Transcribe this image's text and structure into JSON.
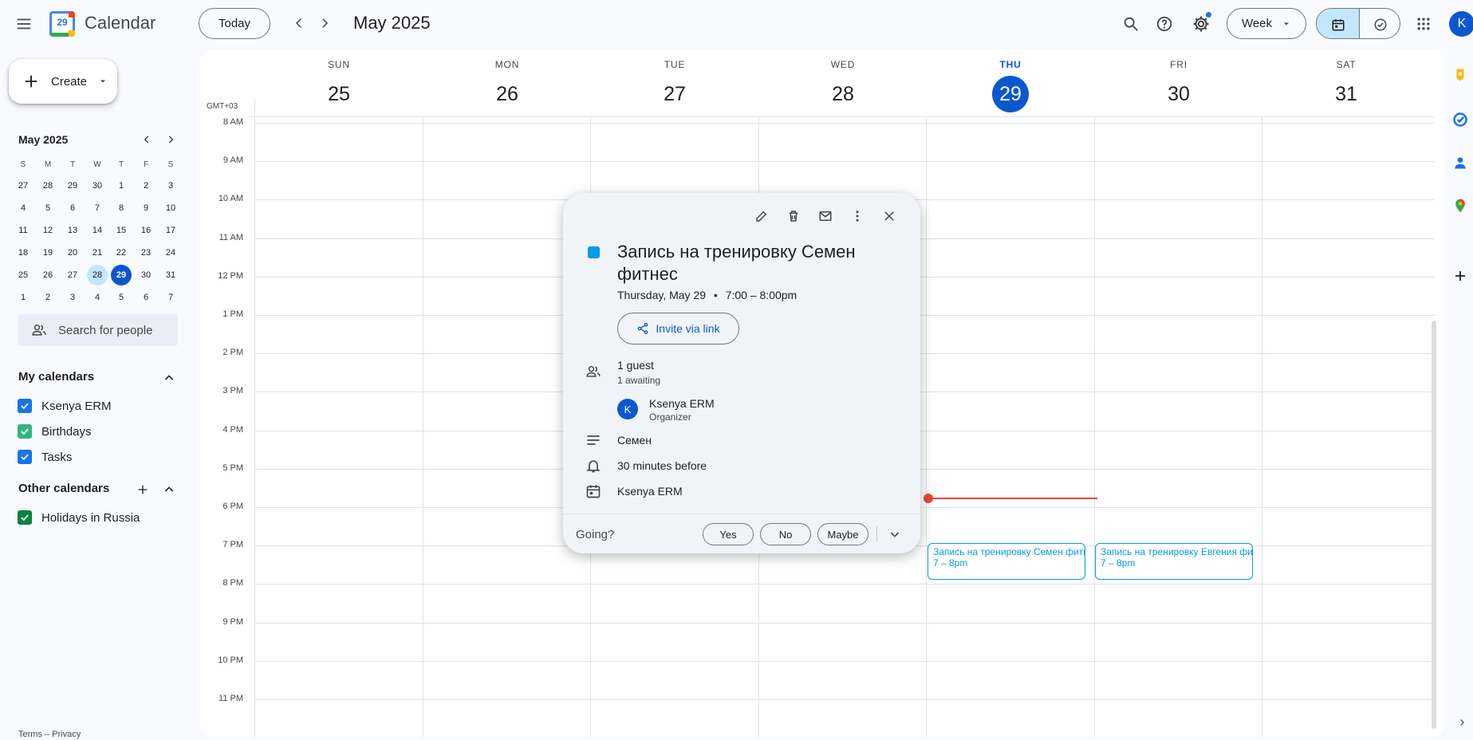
{
  "header": {
    "app_title": "Calendar",
    "logo_day": "29",
    "today_label": "Today",
    "period_title": "May 2025",
    "view_label": "Week",
    "avatar_letter": "K"
  },
  "sidebar": {
    "create_label": "Create",
    "mini_cal": {
      "title": "May 2025",
      "weekday_heads": [
        "S",
        "M",
        "T",
        "W",
        "T",
        "F",
        "S"
      ],
      "weeks": [
        [
          "27",
          "28",
          "29",
          "30",
          "1",
          "2",
          "3"
        ],
        [
          "4",
          "5",
          "6",
          "7",
          "8",
          "9",
          "10"
        ],
        [
          "11",
          "12",
          "13",
          "14",
          "15",
          "16",
          "17"
        ],
        [
          "18",
          "19",
          "20",
          "21",
          "22",
          "23",
          "24"
        ],
        [
          "25",
          "26",
          "27",
          "28",
          "29",
          "30",
          "31"
        ],
        [
          "1",
          "2",
          "3",
          "4",
          "5",
          "6",
          "7"
        ]
      ]
    },
    "search_people_placeholder": "Search for people",
    "my_calendars_title": "My calendars",
    "my_calendars": [
      {
        "label": "Ksenya ERM",
        "color": "#1a73e8"
      },
      {
        "label": "Birthdays",
        "color": "#33b679"
      },
      {
        "label": "Tasks",
        "color": "#1a73e8"
      }
    ],
    "other_calendars_title": "Other calendars",
    "other_calendars": [
      {
        "label": "Holidays in Russia",
        "color": "#0b8043"
      }
    ],
    "footer": "Terms – Privacy"
  },
  "grid": {
    "timezone": "GMT+03",
    "days": [
      {
        "name": "SUN",
        "num": "25"
      },
      {
        "name": "MON",
        "num": "26"
      },
      {
        "name": "TUE",
        "num": "27"
      },
      {
        "name": "WED",
        "num": "28"
      },
      {
        "name": "THU",
        "num": "29"
      },
      {
        "name": "FRI",
        "num": "30"
      },
      {
        "name": "SAT",
        "num": "31"
      }
    ],
    "hours": [
      "8 AM",
      "9 AM",
      "10 AM",
      "11 AM",
      "12 PM",
      "1 PM",
      "2 PM",
      "3 PM",
      "4 PM",
      "5 PM",
      "6 PM",
      "7 PM",
      "8 PM",
      "9 PM",
      "10 PM",
      "11 PM"
    ],
    "events": [
      {
        "title": "Запись на тренировку Семен фитнес",
        "time": "7 – 8pm"
      },
      {
        "title": "Запись на тренировку Евгения фитнес",
        "time": "7 – 8pm"
      }
    ]
  },
  "popup": {
    "title": "Запись на тренировку Семен фитнес",
    "color": "#039be5",
    "date": "Thursday, May 29",
    "time": "7:00 – 8:00pm",
    "invite_label": "Invite via link",
    "guests_count": "1 guest",
    "guests_status": "1 awaiting",
    "guest_name": "Ksenya ERM",
    "guest_role": "Organizer",
    "guest_initial": "K",
    "description": "Семен",
    "reminder": "30 minutes before",
    "calendar": "Ksenya ERM",
    "going_label": "Going?",
    "yes_label": "Yes",
    "no_label": "No",
    "maybe_label": "Maybe"
  }
}
